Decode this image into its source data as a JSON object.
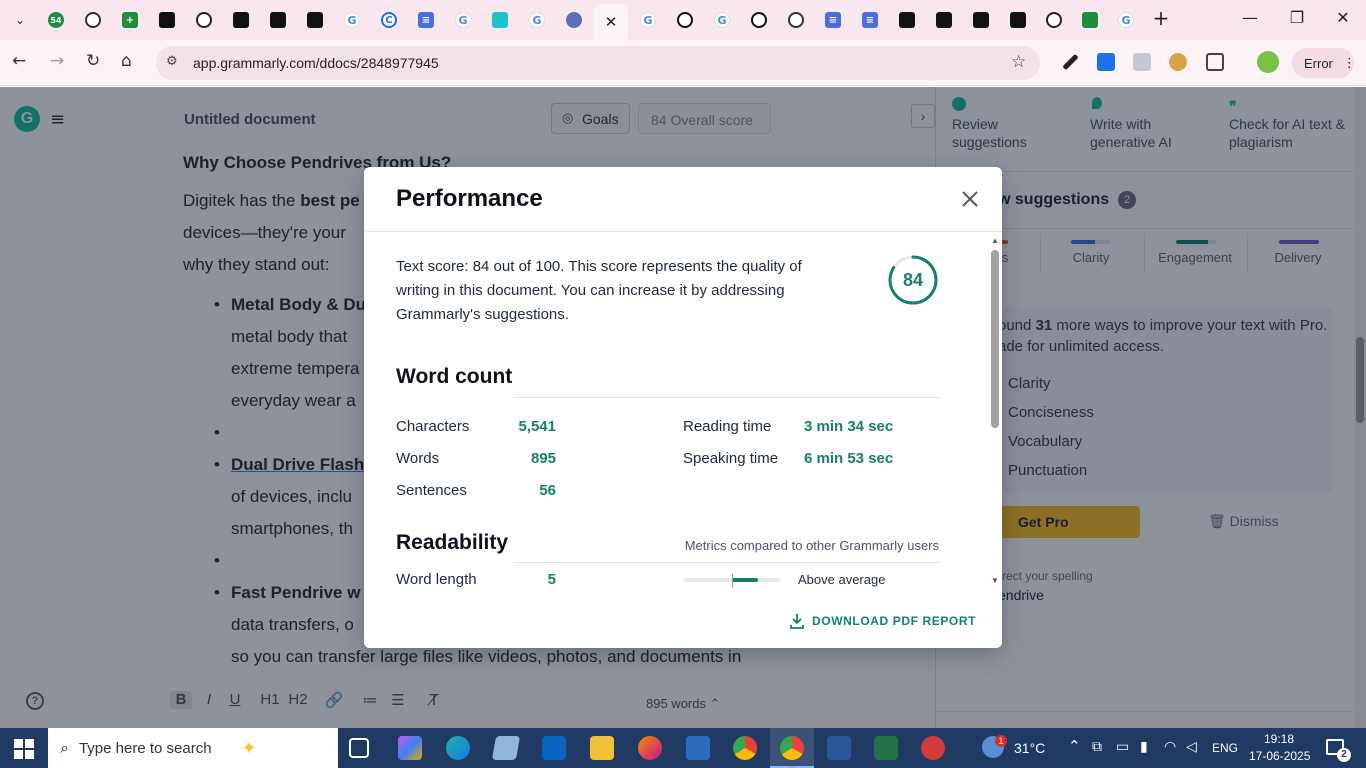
{
  "browser": {
    "url": "app.grammarly.com/ddocs/2848977945",
    "tab_badge": "54",
    "error_label": "Error"
  },
  "editor": {
    "doc_title": "Untitled document",
    "goals_label": "Goals",
    "overall_score_label": "84 Overall score",
    "heading": "Why Choose Pendrives from Us?",
    "para_start": "Digitek has the ",
    "para_bold": "best pe",
    "para_line2": "devices—they're your",
    "para_line3": "why they stand out:",
    "b1_title": "Metal Body & Du",
    "b1_l2": "metal body that",
    "b1_l3": "extreme tempera",
    "b1_l4": "everyday wear a",
    "b2_title": "Dual Drive Flash",
    "b2_l2": "of devices, inclu",
    "b2_l3": "smartphones, th",
    "b3_title": "Fast Pendrive w",
    "b3_l2": "data transfers, o",
    "b3_l3": "so you can transfer large files like videos, photos, and documents in",
    "word_count_label": "895 words",
    "bottom_toolbar": [
      "B",
      "I",
      "U",
      "H1",
      "H2",
      "🔗",
      "≔",
      "☰",
      "T̸"
    ]
  },
  "right_panel": {
    "tabs": [
      {
        "label": "Review suggestions"
      },
      {
        "label": "Write with generative AI"
      },
      {
        "label": "Check for AI text & plagiarism"
      }
    ],
    "header": "w suggestions",
    "header_count": "2",
    "categories": [
      "ess",
      "Clarity",
      "Engagement",
      "Delivery"
    ],
    "pro_text_start": "ound ",
    "pro_count": "31",
    "pro_text_end": " more ways to improve your text with Pro.",
    "pro_line2": "ade for unlimited access.",
    "pro_items": [
      "Clarity",
      "Conciseness",
      "Vocabulary",
      "Punctuation"
    ],
    "get_pro_label": "Get Pro",
    "dismiss_label": "Dismiss",
    "correct_label": "rrect your spelling",
    "correct_word": "endrive"
  },
  "modal": {
    "title": "Performance",
    "score_text": "Text score: 84 out of 100. This score represents the quality of writing in this document. You can increase it by addressing Grammarly's suggestions.",
    "score": "84",
    "score_value": 84,
    "word_count_title": "Word count",
    "stats_left": [
      {
        "label": "Characters",
        "value": "5,541"
      },
      {
        "label": "Words",
        "value": "895"
      },
      {
        "label": "Sentences",
        "value": "56"
      }
    ],
    "stats_right": [
      {
        "label": "Reading time",
        "value": "3 min 34 sec"
      },
      {
        "label": "Speaking time",
        "value": "6 min 53 sec"
      }
    ],
    "readability_title": "Readability",
    "metrics_note": "Metrics compared to other Grammarly users",
    "word_length_label": "Word length",
    "word_length_value": "5",
    "word_length_rating": "Above average",
    "download_label": "DOWNLOAD PDF REPORT"
  },
  "taskbar": {
    "search_placeholder": "Type here to search",
    "weather": "31°C",
    "weather_badge": "1",
    "language": "ENG",
    "time": "19:18",
    "date": "17-06-2025",
    "notification_count": "2"
  },
  "colors": {
    "accent": "#15806b",
    "tabstrip": "#f8e7ee",
    "taskbar": "#1f3b64"
  }
}
